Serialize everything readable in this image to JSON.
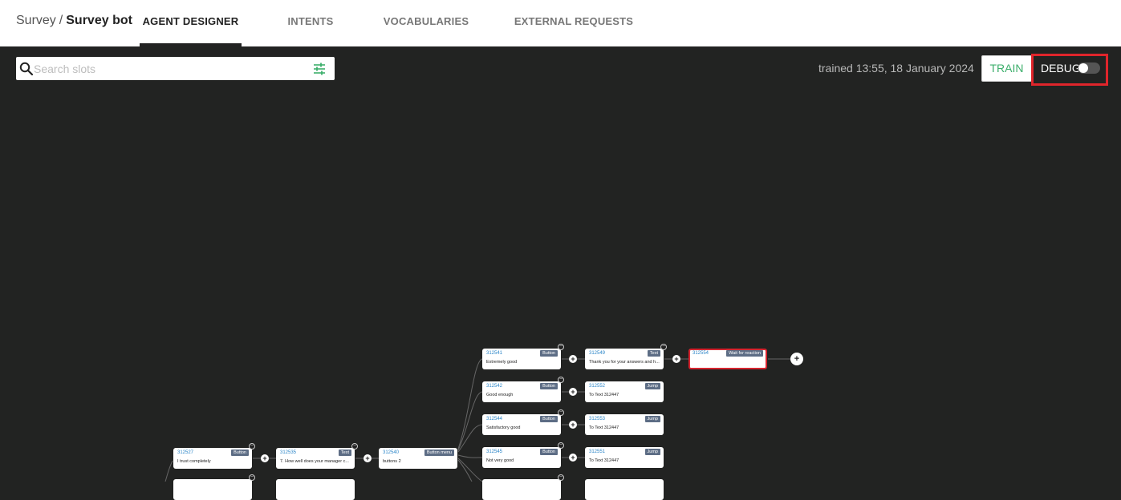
{
  "header": {
    "breadcrumb_parent": "Survey",
    "breadcrumb_sep": "/",
    "breadcrumb_current": "Survey bot",
    "tabs": [
      {
        "label": "AGENT DESIGNER",
        "active": true
      },
      {
        "label": "INTENTS"
      },
      {
        "label": "VOCABULARIES"
      },
      {
        "label": "EXTERNAL REQUESTS"
      }
    ]
  },
  "toolbar": {
    "search_placeholder": "Search slots",
    "trained_status": "trained 13:55, 18 January 2024",
    "train_label": "TRAIN",
    "debug_label": "DEBUG",
    "debug_enabled": false,
    "accent_color": "#3daf6c",
    "highlight_color": "#e0252b"
  },
  "flow": {
    "nodes": [
      {
        "id": "312527",
        "type": "Button",
        "text": "I trust completely"
      },
      {
        "id": "312535",
        "type": "Text",
        "text": "7. How well does your manager c..."
      },
      {
        "id": "312540",
        "type": "Button menu",
        "text": "buttons 2"
      },
      {
        "id": "312541",
        "type": "Button",
        "text": "Extremely good"
      },
      {
        "id": "312542",
        "type": "Button",
        "text": "Good enough"
      },
      {
        "id": "312544",
        "type": "Button",
        "text": "Satisfactory good"
      },
      {
        "id": "312545",
        "type": "Button",
        "text": "Not very good"
      },
      {
        "id": "312549",
        "type": "Text",
        "text": "Thank you for your answers and h..."
      },
      {
        "id": "312552",
        "type": "Jump",
        "text": "To Text 312447"
      },
      {
        "id": "312553",
        "type": "Jump",
        "text": "To Text 312447"
      },
      {
        "id": "312551",
        "type": "Jump",
        "text": "To Text 312447"
      },
      {
        "id": "312554",
        "type": "Wait for reaction",
        "text": ""
      }
    ]
  }
}
